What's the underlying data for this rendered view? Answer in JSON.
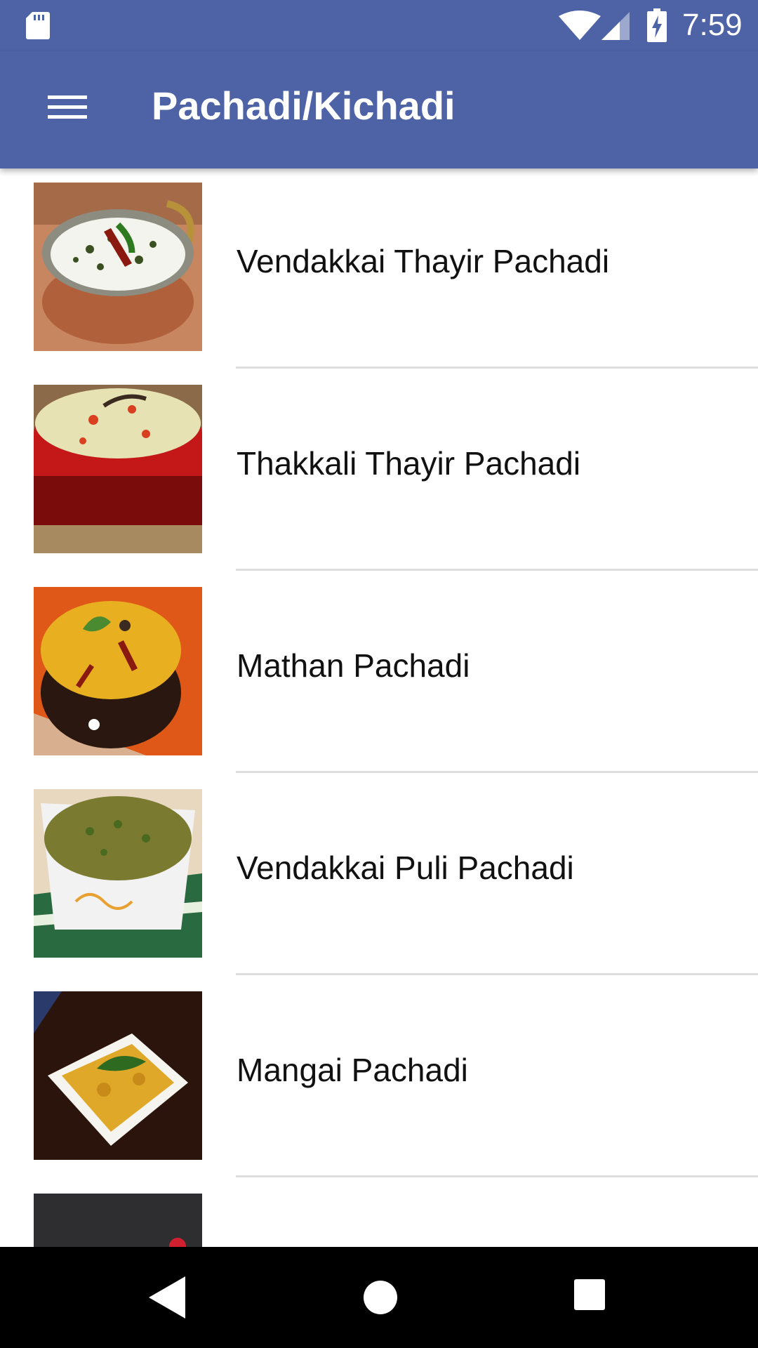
{
  "status_bar": {
    "time": "7:59",
    "icons": [
      "sd-card-icon",
      "wifi-icon",
      "cell-signal-icon",
      "battery-charging-icon"
    ]
  },
  "app_bar": {
    "title": "Pachadi/Kichadi",
    "menu_icon": "hamburger-menu-icon"
  },
  "recipes": [
    {
      "name": "Vendakkai Thayir Pachadi",
      "image": "dish-photo-curd-okra"
    },
    {
      "name": "Thakkali Thayir Pachadi",
      "image": "dish-photo-curd-tomato"
    },
    {
      "name": "Mathan Pachadi",
      "image": "dish-photo-pumpkin"
    },
    {
      "name": "Vendakkai Puli Pachadi",
      "image": "dish-photo-tamarind-okra"
    },
    {
      "name": "Mangai Pachadi",
      "image": "dish-photo-mango"
    },
    {
      "name": "",
      "image": "dish-photo-partial"
    }
  ],
  "nav_bar": {
    "icons": [
      "back-icon",
      "home-icon",
      "recents-icon"
    ]
  },
  "colors": {
    "primary": "#4e62a6",
    "divider": "#dddddd",
    "nav_bar": "#000000"
  }
}
